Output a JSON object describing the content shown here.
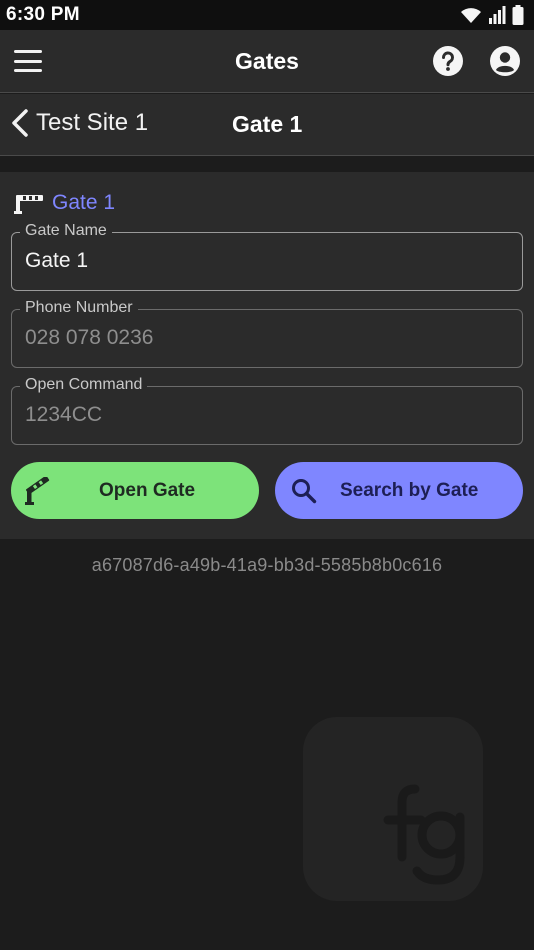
{
  "status": {
    "time": "6:30 PM"
  },
  "app": {
    "title": "Gates"
  },
  "nav": {
    "back_label": "Test Site 1",
    "title": "Gate 1"
  },
  "gate": {
    "heading": "Gate 1",
    "fields": [
      {
        "label": "Gate Name",
        "value": "Gate 1"
      },
      {
        "label": "Phone Number",
        "value": "028 078 0236"
      },
      {
        "label": "Open Command",
        "value": "1234CC"
      }
    ]
  },
  "actions": {
    "open_label": "Open Gate",
    "search_label": "Search by Gate"
  },
  "uuid": "a67087d6-a49b-41a9-bb3d-5585b8b0c616",
  "logo_text": "fg",
  "colors": {
    "accent": "#7f86ff",
    "open_button": "#7de37a",
    "search_button": "#7f86ff",
    "background": "#1c1c1c",
    "surface": "#2b2b2b"
  }
}
